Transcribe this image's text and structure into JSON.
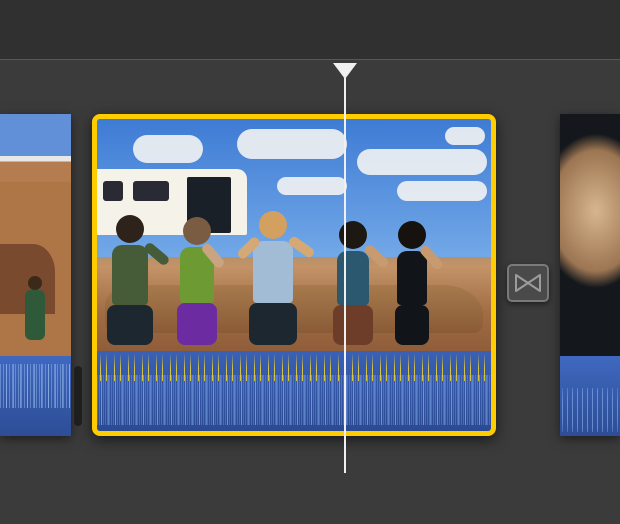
{
  "colors": {
    "selection_border": "#ffcc00",
    "playhead": "#f0f0f0",
    "audio_track": "#3a60b6",
    "audio_peaks": "#e8cf3a",
    "background": "#3b3b3b",
    "top_bar": "#303030"
  },
  "timeline": {
    "selected_clip_index": 1,
    "playhead_position_pct": 55,
    "clips": [
      {
        "id": "clip-a",
        "partial": "left",
        "selected": false,
        "has_audio": true
      },
      {
        "id": "clip-b",
        "partial": "none",
        "selected": true,
        "has_audio": true
      },
      {
        "id": "clip-c",
        "partial": "right",
        "selected": false,
        "has_audio": true
      }
    ],
    "transitions": [
      {
        "between": [
          "clip-b",
          "clip-c"
        ],
        "type": "cross-dissolve"
      }
    ]
  }
}
